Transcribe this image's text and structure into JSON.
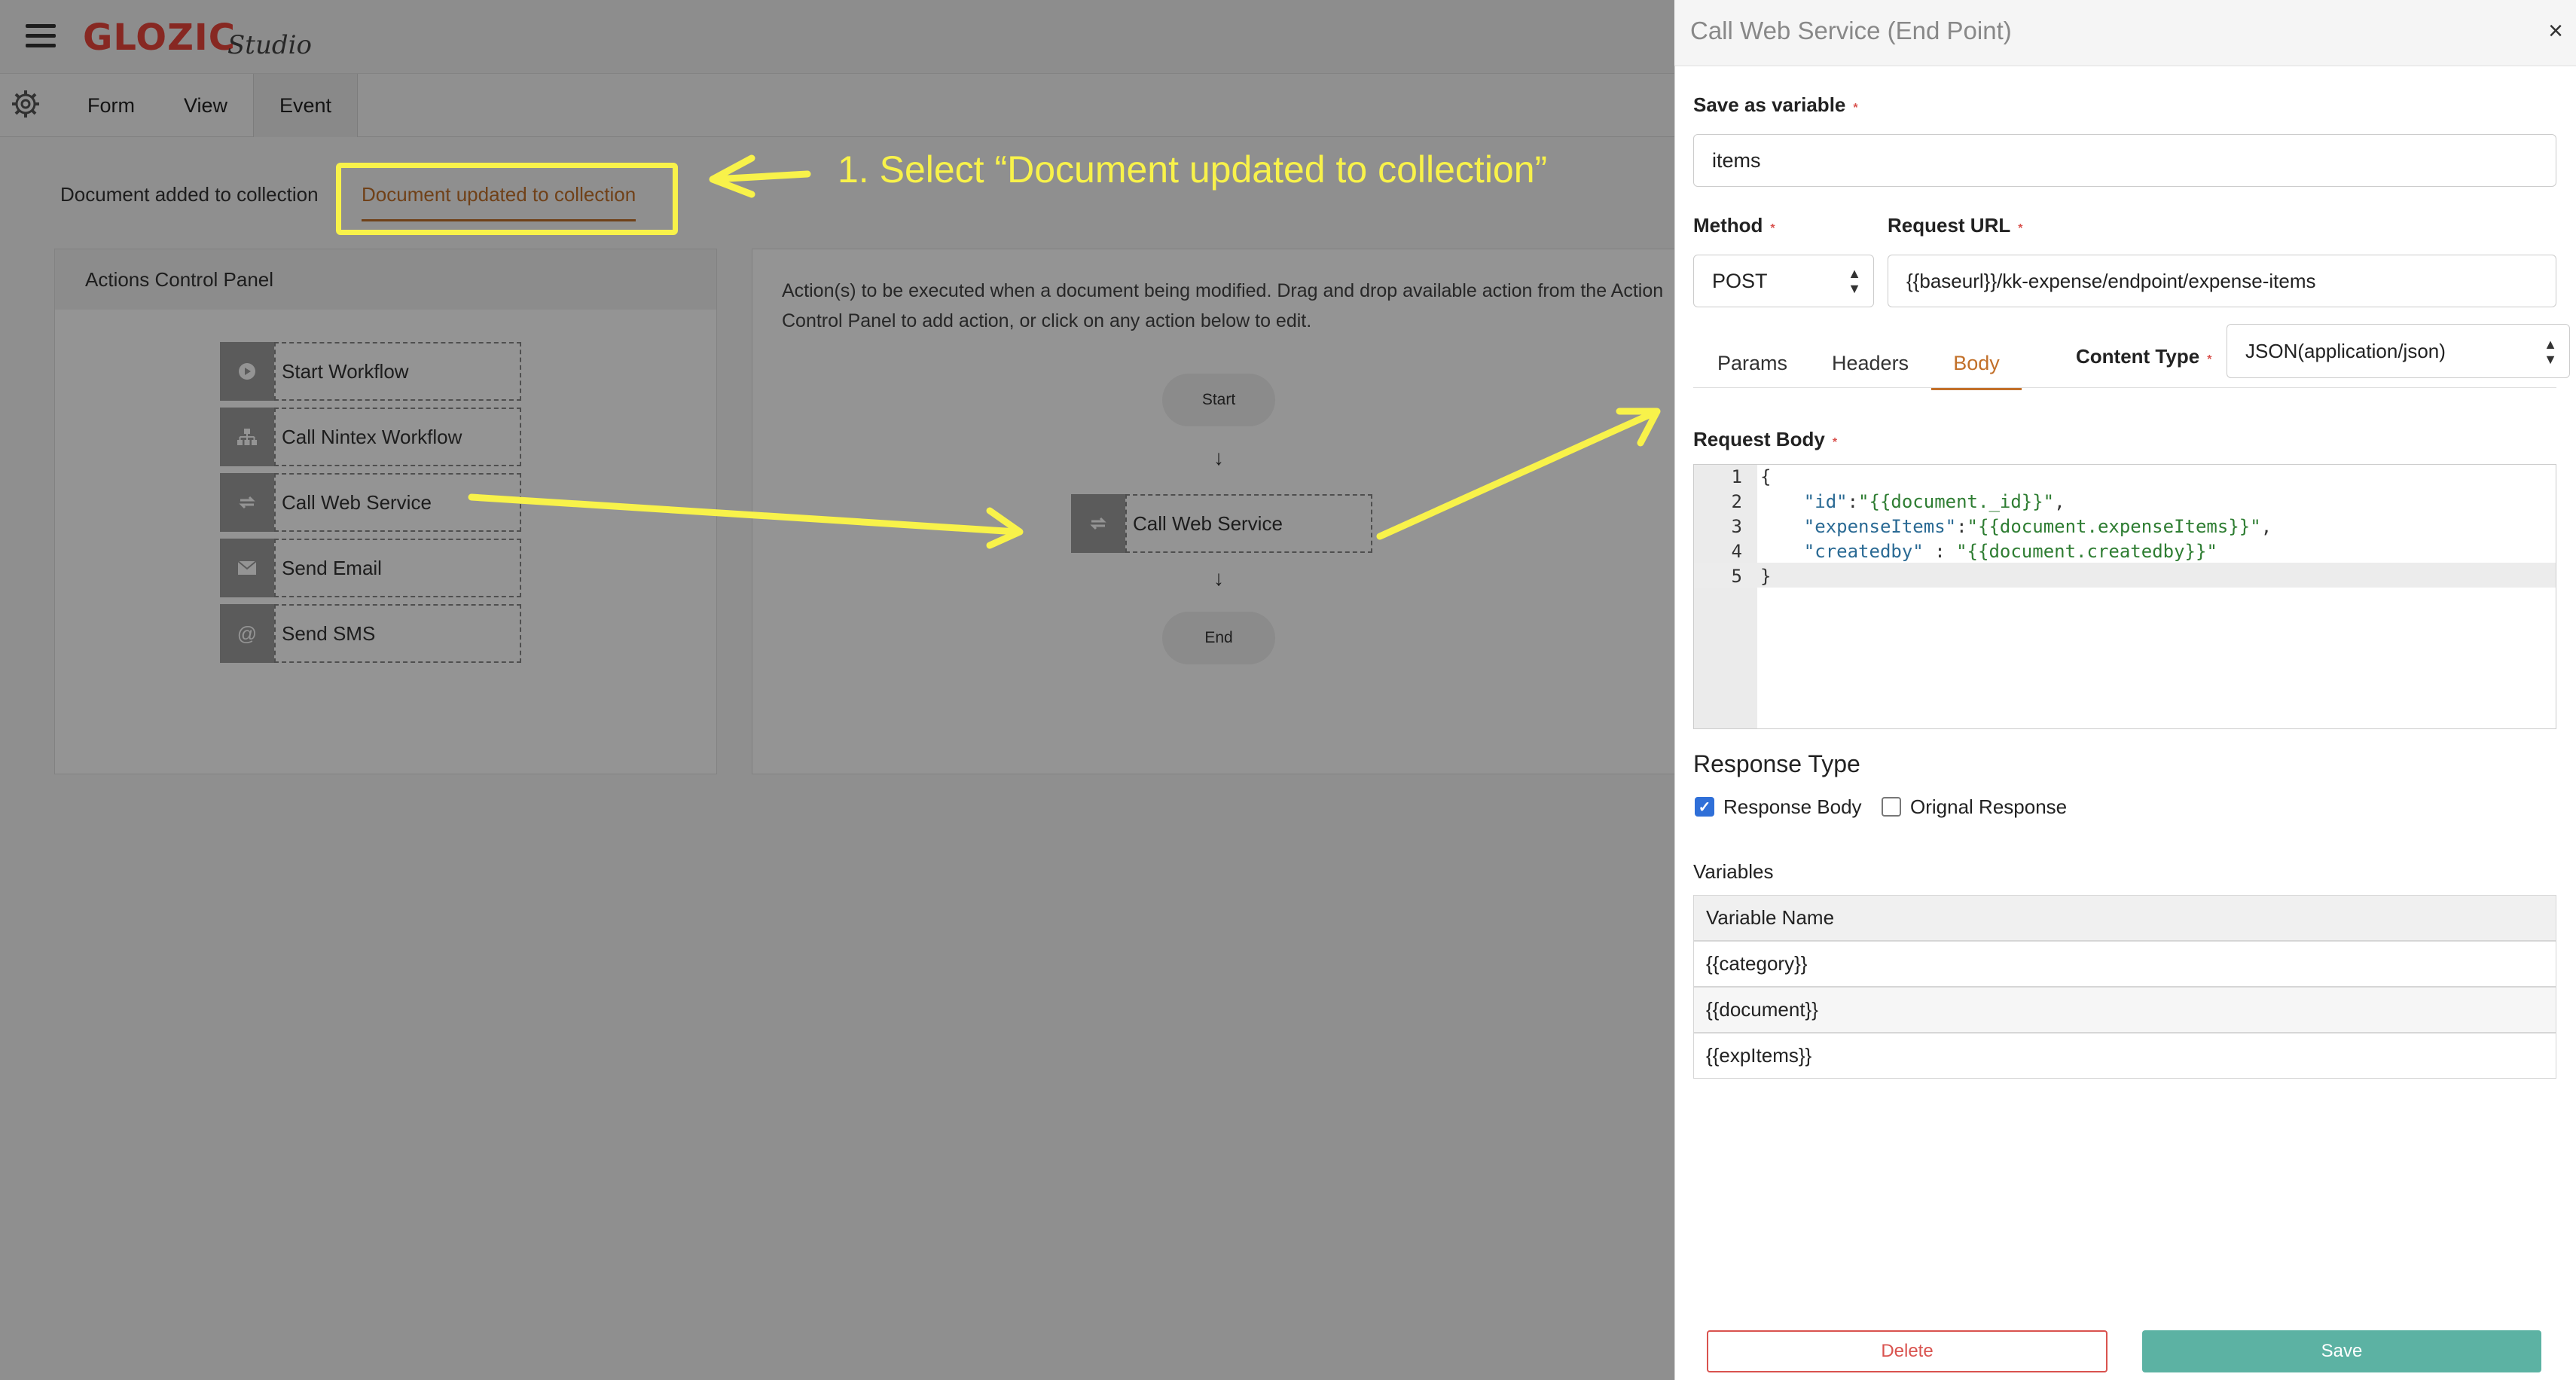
{
  "app": {
    "logo": "GLOZIC",
    "logo_sub": "Studio"
  },
  "toolbar": {
    "tabs": [
      "Form",
      "View",
      "Event"
    ]
  },
  "event_tabs": {
    "added": "Document added to collection",
    "updated": "Document updated to collection"
  },
  "actions_panel": {
    "title": "Actions Control Panel",
    "items": [
      {
        "label": "Start Workflow",
        "icon": "play-icon"
      },
      {
        "label": "Call Nintex Workflow",
        "icon": "sitemap-icon"
      },
      {
        "label": "Call Web Service",
        "icon": "exchange-icon"
      },
      {
        "label": "Send Email",
        "icon": "envelope-icon"
      },
      {
        "label": "Send SMS",
        "icon": "at-icon"
      }
    ]
  },
  "flow": {
    "description": "Action(s) to be executed when a document being modified. Drag and drop available action from the Action Control Panel to add action, or click on any action below to edit.",
    "start": "Start",
    "node": "Call Web Service",
    "end": "End"
  },
  "annotation": {
    "text": "1. Select “Document updated to collection”",
    "color": "#f8f24a"
  },
  "side_panel": {
    "title": "Call Web Service (End Point)",
    "close": "×",
    "save_as_label": "Save as variable",
    "save_as_value": "items",
    "method_label": "Method",
    "method_value": "POST",
    "url_label": "Request URL",
    "url_value": "{{baseurl}}/kk-expense/endpoint/expense-items",
    "tabs": [
      "Params",
      "Headers",
      "Body"
    ],
    "active_tab": "Body",
    "content_type_label": "Content Type",
    "content_type_value": "JSON(application/json)",
    "request_body_label": "Request Body",
    "required_mark": "*",
    "code": {
      "line_numbers": [
        "1",
        "2",
        "3",
        "4",
        "5"
      ],
      "l1": "{",
      "l2_key": "\"id\"",
      "l2_sep": ":",
      "l2_val": "\"{{document._id}}\"",
      "l2_end": ",",
      "l3_key": "\"expenseItems\"",
      "l3_sep": ":",
      "l3_val": "\"{{document.expenseItems}}\"",
      "l3_end": ",",
      "l4_key": "\"createdby\"",
      "l4_sep": " : ",
      "l4_val": "\"{{document.createdby}}\"",
      "l5": "}"
    },
    "response_type_label": "Response Type",
    "response_body_label": "Response Body",
    "response_body_checked": true,
    "original_response_label": "Orignal Response",
    "original_response_checked": false,
    "variables_label": "Variables",
    "variables_header": "Variable Name",
    "variables": [
      "{{category}}",
      "{{document}}",
      "{{expItems}}"
    ],
    "delete_label": "Delete",
    "save_label": "Save"
  },
  "colors": {
    "accent": "#c2702a",
    "save": "#5cb2a3",
    "delete": "#d9534f",
    "required": "#d9534f",
    "logo": "#e8453c"
  }
}
